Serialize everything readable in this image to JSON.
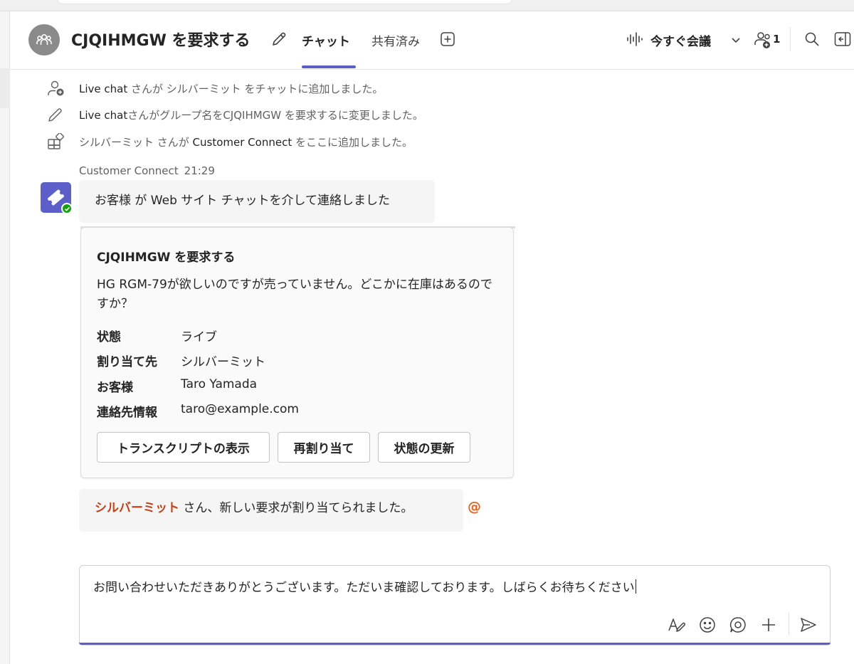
{
  "header": {
    "title": "CJQIHMGW を要求する",
    "tabs": [
      {
        "label": "チャット",
        "active": true
      },
      {
        "label": "共有済み",
        "active": false
      }
    ],
    "meet_label": "今すぐ会議",
    "participant_count": "1",
    "accent_color": "#5b5fc7"
  },
  "system_messages": [
    {
      "icon": "add-person-icon",
      "actor": "Live chat",
      "rest": " さんが シルバーミット をチャットに追加しました。"
    },
    {
      "icon": "pencil-icon",
      "actor": "Live chat",
      "rest": "さんがグループ名をCJQIHMGW を要求するに変更しました。"
    },
    {
      "icon": "apps-icon",
      "pre": "シルバーミット さんが ",
      "app": "Customer Connect",
      "post": " をここに追加しました。"
    }
  ],
  "message": {
    "sender": "Customer Connect",
    "time": "21:29",
    "text": "お客様 が Web サイト チャットを介して連絡しました"
  },
  "card": {
    "title": "CJQIHMGW を要求する",
    "description": "HG RGM-79が欲しいのですが売っていません。どこかに在庫はあるのですか？",
    "fields": [
      {
        "key": "状態",
        "value": "ライブ"
      },
      {
        "key": "割り当て先",
        "value": "シルバーミット"
      },
      {
        "key": "お客様",
        "value": "Taro Yamada"
      },
      {
        "key": "連絡先情報",
        "value": "taro@example.com"
      }
    ],
    "buttons": [
      "トランスクリプトの表示",
      "再割り当て",
      "状態の更新"
    ]
  },
  "mention_message": {
    "mention": "シルバーミット",
    "text": " さん、新しい要求が割り当てられました。",
    "mention_color": "#c4421a"
  },
  "compose": {
    "value": "お問い合わせいただきありがとうございます。ただいま確認しております。しばらくお待ちください"
  }
}
